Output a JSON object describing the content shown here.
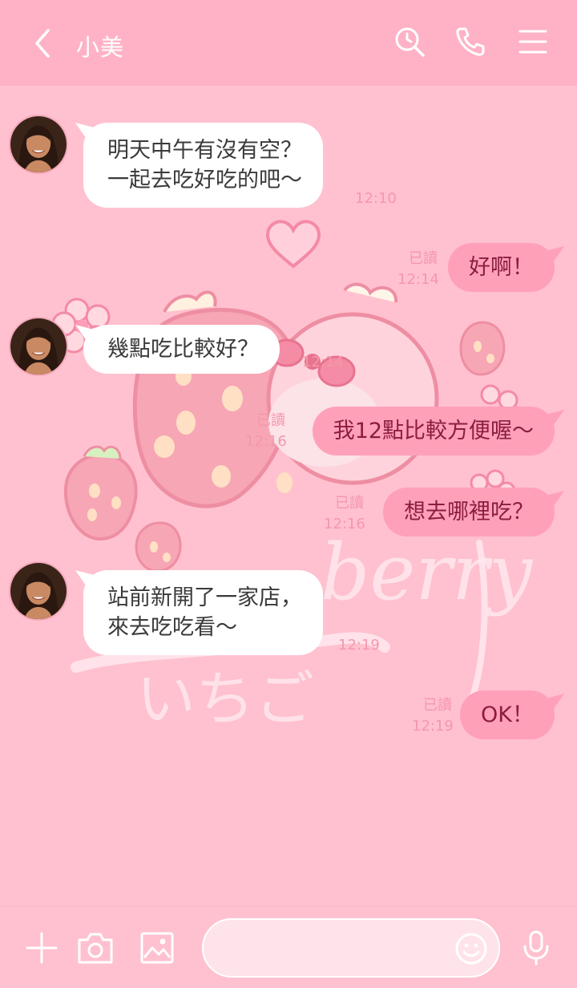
{
  "header": {
    "title": "小美"
  },
  "messages": [
    {
      "type": "incoming",
      "text": "明天中午有沒有空？\n一起去吃好吃的吧～",
      "time": "12:10"
    },
    {
      "type": "outgoing",
      "text": "好啊！",
      "read": "已讀",
      "time": "12:14"
    },
    {
      "type": "incoming",
      "text": "幾點吃比較好？",
      "time": "12:14"
    },
    {
      "type": "outgoing",
      "text": "我12點比較方便喔～",
      "read": "已讀",
      "time": "12:16"
    },
    {
      "type": "outgoing",
      "text": "想去哪裡吃？",
      "read": "已讀",
      "time": "12:16"
    },
    {
      "type": "incoming",
      "text": "站前新開了一家店，\n來去吃吃看～",
      "time": "12:19"
    },
    {
      "type": "outgoing",
      "text": "OK！",
      "read": "已讀",
      "time": "12:19"
    }
  ],
  "background": {
    "text_latin": "berry",
    "text_kana": "いちご"
  },
  "footer": {
    "input_value": ""
  },
  "colors": {
    "header": "#ffb2c6",
    "chat_bg": "#ffc1cf",
    "outgoing_bubble": "#ffa0b9",
    "incoming_bubble": "#ffffff",
    "timestamp": "#f597ad"
  }
}
